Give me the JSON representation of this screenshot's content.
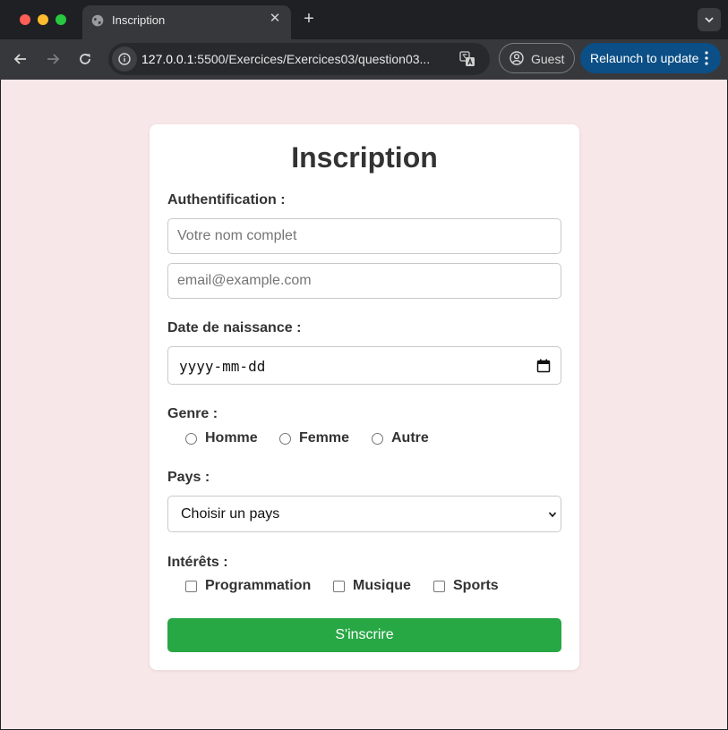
{
  "browser": {
    "tab_title": "Inscription",
    "url_host": "127.0.0.1",
    "url_rest": ":5500/Exercices/Exercices03/question03...",
    "profile_label": "Guest",
    "relaunch_label": "Relaunch to update",
    "icons": [
      "globe-icon",
      "close-icon",
      "plus-icon",
      "chevron-down-icon",
      "arrow-left-icon",
      "arrow-right-icon",
      "reload-icon",
      "info-icon",
      "translate-icon",
      "user-circle-icon",
      "more-vertical-icon"
    ]
  },
  "colors": {
    "page_background": "#f8e7e8",
    "card_background": "#ffffff",
    "submit_button": "#28a745",
    "relaunch_button": "#0b4f86"
  },
  "form": {
    "title": "Inscription",
    "auth_label": "Authentification :",
    "name_placeholder": "Votre nom complet",
    "email_placeholder": "email@example.com",
    "birthdate_label": "Date de naissance :",
    "birthdate_placeholder": "yyyy-mm-dd",
    "gender_label": "Genre :",
    "gender_options": [
      "Homme",
      "Femme",
      "Autre"
    ],
    "country_label": "Pays :",
    "country_selected": "Choisir un pays",
    "interests_label": "Intérêts :",
    "interest_options": [
      "Programmation",
      "Musique",
      "Sports"
    ],
    "submit_label": "S'inscrire"
  }
}
